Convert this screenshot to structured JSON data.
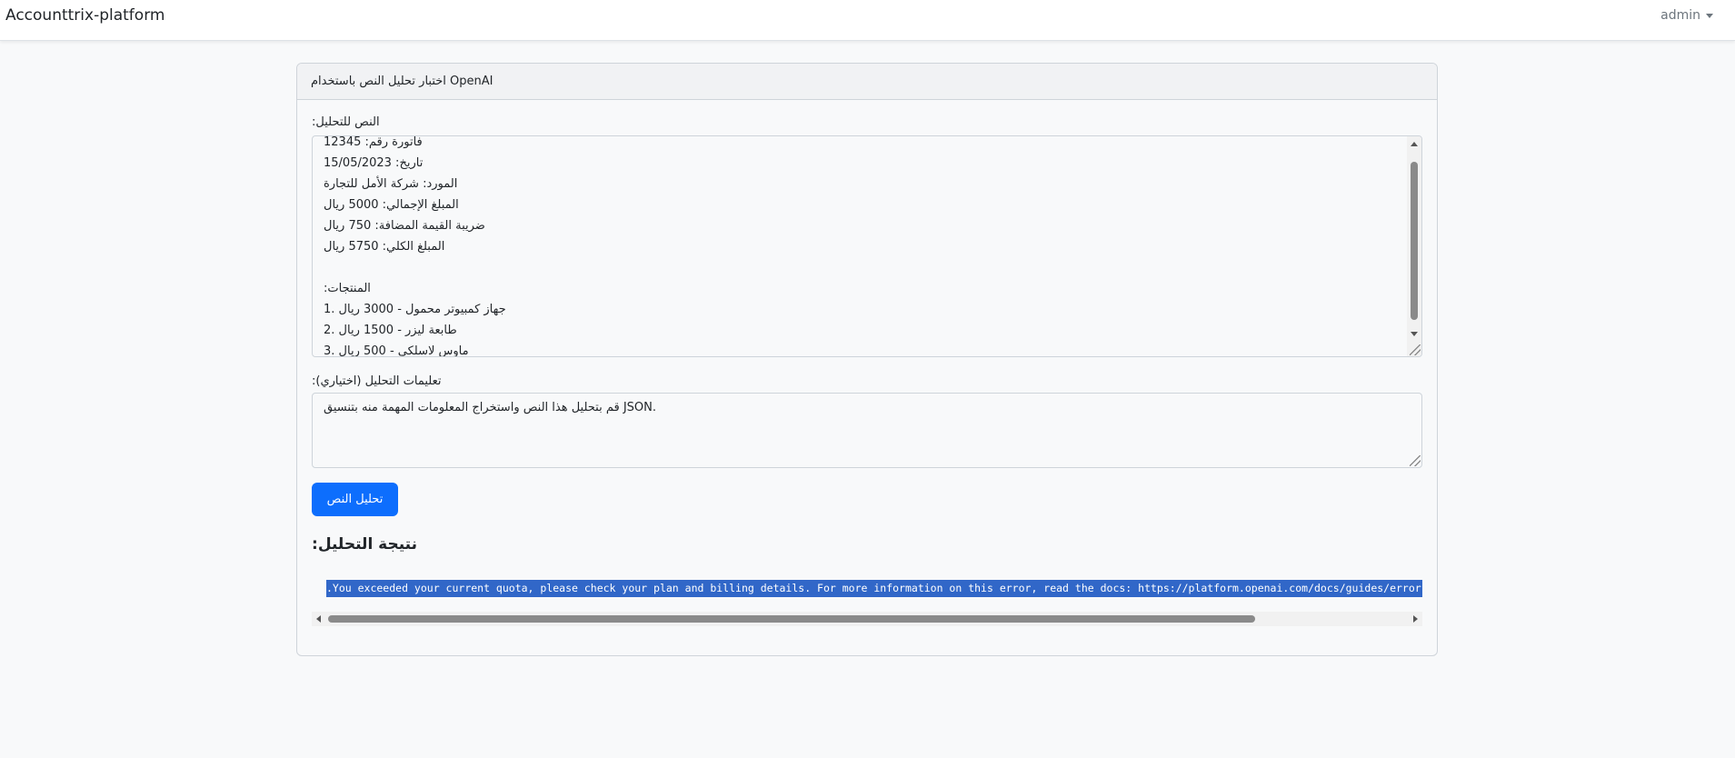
{
  "navbar": {
    "brand": "Accounttrix-platform",
    "user": "admin"
  },
  "card": {
    "header": "اختبار تحليل النص باستخدام OpenAI",
    "text_label": ":النص للتحليل",
    "text_value": "فاتورة رقم: 12345\n15/05/2023 :تاريخ\nالمورد: شركة الأمل للتجارة\nالمبلغ الإجمالي: 5000 ريال\nضريبة القيمة المضافة: 750 ريال\nالمبلغ الكلي: 5750 ريال\n\n:المنتجات\n1. جهاز كمبيوتر محمول - 3000 ريال\n2. طابعة ليزر - 1500 ريال\n3. ماوس لاسلكي - 500 ريال",
    "instructions_label": ":تعليمات التحليل (اختياري)",
    "instructions_value": "قم بتحليل هذا النص واستخراج المعلومات المهمة منه بتنسيق JSON.",
    "analyze_button": "تحليل النص",
    "result_heading": ":نتيجة التحليل",
    "result_text": ".You exceeded your current quota, please check your plan and billing details. For more information on this error, read the docs: https://platform.openai.com/docs/guides/error-codes/api-errors"
  },
  "colors": {
    "primary": "#0d6efd",
    "selection": "#3167c8"
  }
}
